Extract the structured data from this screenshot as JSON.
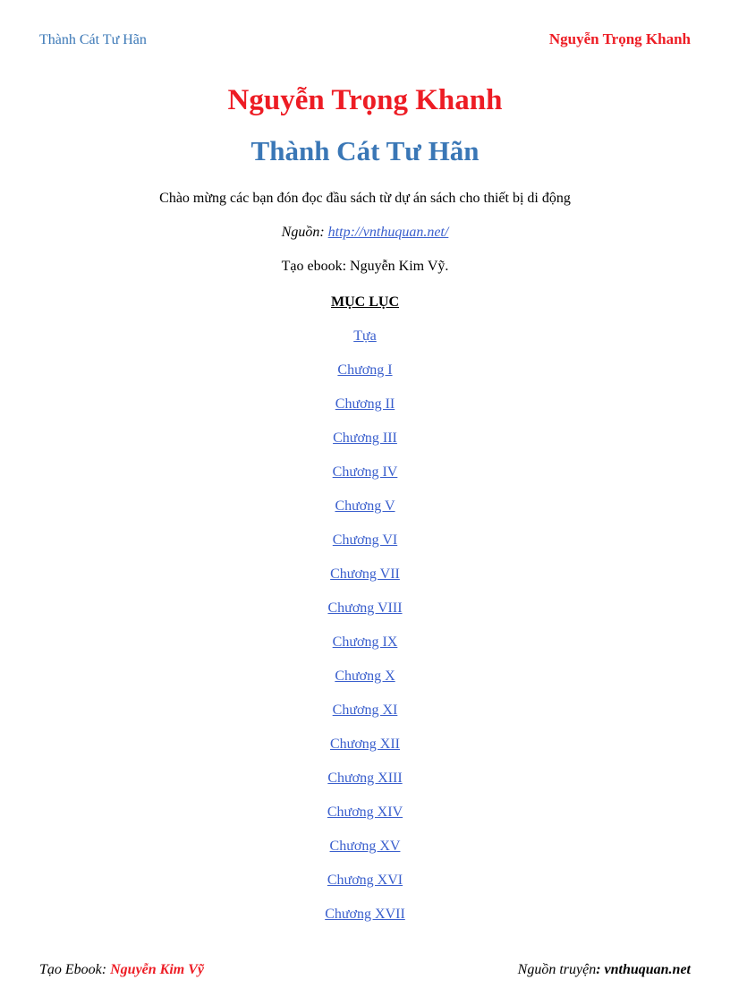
{
  "header": {
    "left": "Thành Cát Tư Hãn",
    "right": "Nguyễn Trọng Khanh"
  },
  "title_author": "Nguyễn Trọng Khanh",
  "title_book": "Thành Cát Tư Hãn",
  "welcome": "Chào mừng các bạn đón đọc đầu sách từ dự án sách cho thiết bị di động",
  "source": {
    "label": "Nguồn: ",
    "url": "http://vnthuquan.net/"
  },
  "ebook_creator": "Tạo ebook: Nguyễn Kim Vỹ.",
  "toc_heading": "MỤC LỤC",
  "toc": [
    "Tựa",
    "Chương I",
    "Chương II",
    "Chương III",
    "Chương IV",
    "Chương V",
    "Chương VI",
    "Chương VII",
    "Chương VIII",
    "Chương IX",
    "Chương X",
    "Chương XI",
    "Chương XII",
    "Chương XIII",
    "Chương XIV",
    "Chương XV",
    "Chương XVI",
    "Chương XVII"
  ],
  "footer": {
    "left_label": "Tạo Ebook",
    "left_name": "Nguyễn Kim Vỹ",
    "right_label": "Nguồn truyện",
    "right_name": "vnthuquan.net"
  }
}
